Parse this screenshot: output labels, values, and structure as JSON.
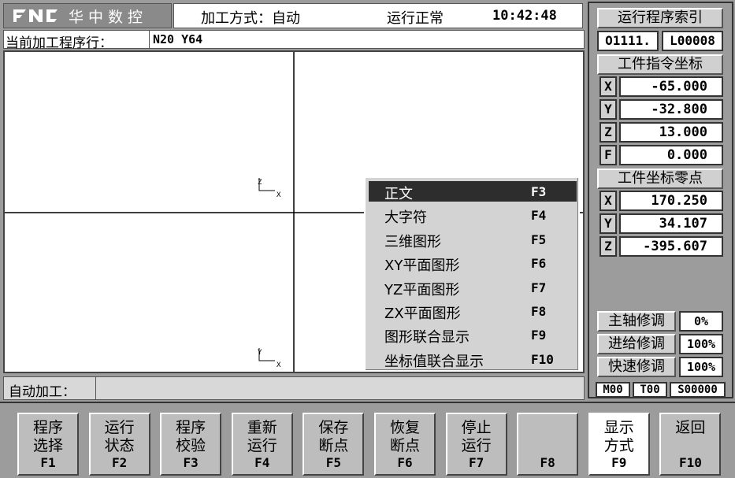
{
  "header": {
    "brand": "华中数控",
    "mode_label": "加工方式：自动",
    "run_status": "运行正常",
    "clock": "10:42:48"
  },
  "program_line": {
    "label": "当前加工程序行：",
    "value": "N20 Y64"
  },
  "graph": {
    "axes_top_left": {
      "v": "Z",
      "h": "X"
    },
    "axes_bottom_left": {
      "v": "Y",
      "h": "X"
    }
  },
  "display_menu": [
    {
      "label": "正文",
      "key": "F3",
      "selected": true
    },
    {
      "label": "大字符",
      "key": "F4"
    },
    {
      "label": "三维图形",
      "key": "F5"
    },
    {
      "label": "XY平面图形",
      "key": "F6"
    },
    {
      "label": "YZ平面图形",
      "key": "F7"
    },
    {
      "label": "ZX平面图形",
      "key": "F8"
    },
    {
      "label": "图形联合显示",
      "key": "F9"
    },
    {
      "label": "坐标值联合显示",
      "key": "F10"
    }
  ],
  "status_bar": {
    "label": "自动加工：",
    "value": ""
  },
  "right_panel": {
    "program_index_title": "运行程序索引",
    "program_no": "O1111.",
    "line_no": "L00008",
    "cmd_coords_title": "工件指令坐标",
    "cmd_coords": [
      {
        "axis": "X",
        "value": "-65.000"
      },
      {
        "axis": "Y",
        "value": "-32.800"
      },
      {
        "axis": "Z",
        "value": "13.000"
      },
      {
        "axis": "F",
        "value": "0.000"
      }
    ],
    "work_zero_title": "工件坐标零点",
    "work_zero": [
      {
        "axis": "X",
        "value": "170.250"
      },
      {
        "axis": "Y",
        "value": "34.107"
      },
      {
        "axis": "Z",
        "value": "-395.607"
      }
    ],
    "overrides": [
      {
        "label": "主轴修调",
        "value": "0%"
      },
      {
        "label": "进给修调",
        "value": "100%"
      },
      {
        "label": "快速修调",
        "value": "100%"
      }
    ],
    "m_code": "M00",
    "t_code": "T00",
    "s_code": "S00000"
  },
  "softkeys": [
    {
      "l1": "程序",
      "l2": "选择",
      "key": "F1"
    },
    {
      "l1": "运行",
      "l2": "状态",
      "key": "F2"
    },
    {
      "l1": "程序",
      "l2": "校验",
      "key": "F3"
    },
    {
      "l1": "重新",
      "l2": "运行",
      "key": "F4"
    },
    {
      "l1": "保存",
      "l2": "断点",
      "key": "F5"
    },
    {
      "l1": "恢复",
      "l2": "断点",
      "key": "F6"
    },
    {
      "l1": "停止",
      "l2": "运行",
      "key": "F7"
    },
    {
      "l1": "",
      "l2": "",
      "key": "F8"
    },
    {
      "l1": "显示",
      "l2": "方式",
      "key": "F9",
      "active": true
    },
    {
      "l1": "返回",
      "l2": "",
      "key": "F10"
    }
  ]
}
